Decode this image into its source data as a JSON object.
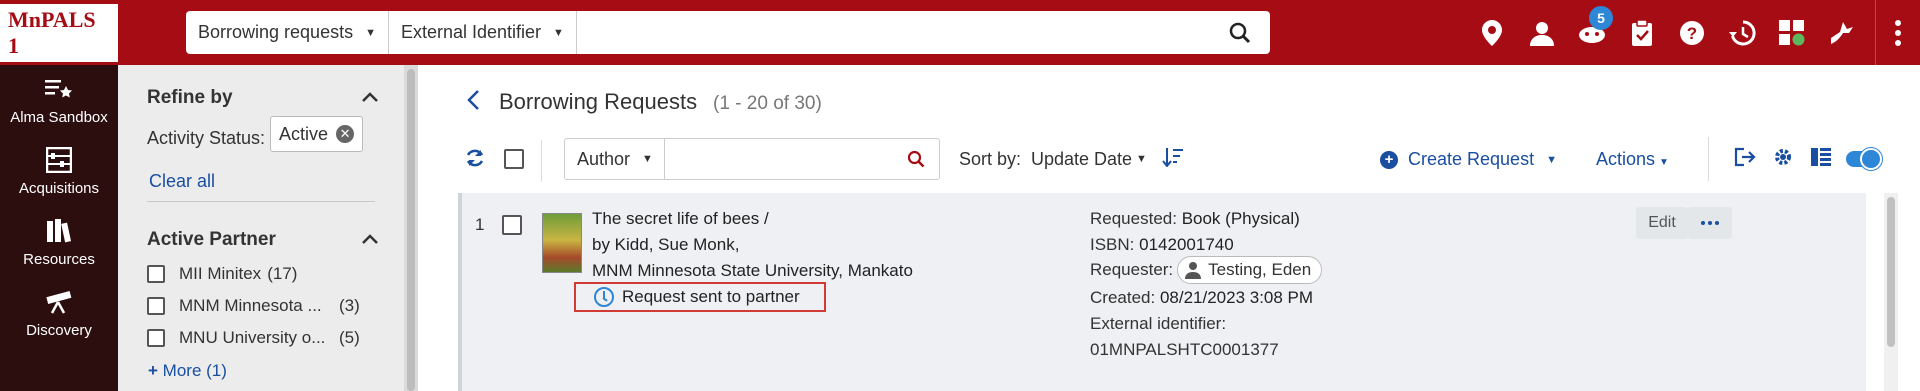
{
  "brand": {
    "logo_text": "MnPALS 1"
  },
  "search": {
    "type_select": "Borrowing requests",
    "field_select": "External Identifier",
    "value": ""
  },
  "notifications": {
    "count": "5"
  },
  "leftnav": {
    "items": [
      {
        "label": "Alma Sandbox",
        "icon": "star-menu-icon"
      },
      {
        "label": "Acquisitions",
        "icon": "abacus-icon"
      },
      {
        "label": "Resources",
        "icon": "books-icon"
      },
      {
        "label": "Discovery",
        "icon": "telescope-icon"
      }
    ]
  },
  "refine": {
    "title": "Refine by",
    "activity_label": "Activity Status:",
    "activity_value": "Active",
    "clear_all": "Clear all",
    "partner_title": "Active Partner",
    "partners": [
      {
        "name": "MII Minitex",
        "count": "(17)"
      },
      {
        "name": "MNM Minnesota ...",
        "count": "(3)"
      },
      {
        "name": "MNU University o...",
        "count": "(5)"
      }
    ],
    "more": "More (1)"
  },
  "page": {
    "title": "Borrowing Requests",
    "count": "(1 - 20 of 30)"
  },
  "toolbar": {
    "filter_field": "Author",
    "filter_value": "",
    "sort_label": "Sort by:",
    "sort_value": "Update Date",
    "create_request": "Create Request",
    "actions": "Actions"
  },
  "rows": [
    {
      "num": "1",
      "title": "The secret life of bees /",
      "by": "by Kidd, Sue Monk,",
      "institution": "MNM Minnesota State University, Mankato",
      "status": "Request sent to partner",
      "requested_label": "Requested:",
      "requested_value": "Book (Physical)",
      "isbn_label": "ISBN:",
      "isbn_value": "0142001740",
      "requester_label": "Requester:",
      "requester_value": "Testing, Eden",
      "created_label": "Created:",
      "created_value": "08/21/2023 3:08 PM",
      "extid_label": "External identifier:",
      "extid_value": "01MNPALSHTC0001377",
      "edit": "Edit"
    }
  ],
  "colors": {
    "brand": "#a50c14",
    "nav": "#2d0e0e",
    "link": "#1a4ea0",
    "accent": "#2e86d6",
    "highlight": "#d23a35"
  }
}
